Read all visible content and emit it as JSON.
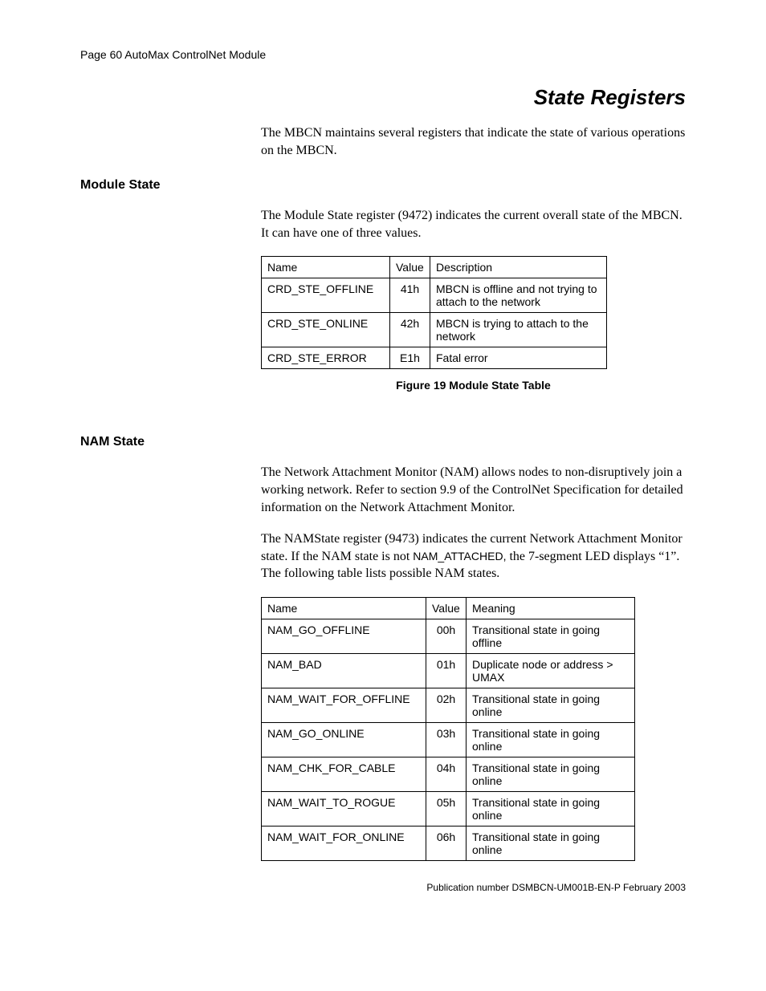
{
  "header": "Page 60  AutoMax ControlNet Module",
  "title": "State Registers",
  "intro": "The MBCN maintains several registers that indicate the state of various operations on the MBCN.",
  "sec1": {
    "heading": "Module State",
    "para": "The Module State register (9472) indicates the current overall state of the MBCN. It can have one of three values.",
    "table": {
      "headers": [
        "Name",
        "Value",
        "Description"
      ],
      "rows": [
        {
          "name": "CRD_STE_OFFLINE",
          "value": "41h",
          "desc": "MBCN is offline and not trying to attach to the network"
        },
        {
          "name": "CRD_STE_ONLINE",
          "value": "42h",
          "desc": "MBCN is trying to attach to the network"
        },
        {
          "name": "CRD_STE_ERROR",
          "value": "E1h",
          "desc": "Fatal error"
        }
      ]
    },
    "caption": "Figure 19 Module State Table"
  },
  "sec2": {
    "heading": "NAM State",
    "para1": "The Network Attachment Monitor (NAM) allows nodes to non-disruptively join a working network.  Refer to section 9.9 of the ControlNet Specification for detailed information on the Network Attachment Monitor.",
    "para2_a": "The NAMState register (9473) indicates the current Network Attachment Monitor state. If the NAM state is not ",
    "para2_code": "NAM_ATTACHED,",
    "para2_b": " the 7-segment LED displays “1”.   The following table lists possible NAM states.",
    "table": {
      "headers": [
        "Name",
        "Value",
        "Meaning"
      ],
      "rows": [
        {
          "name": "NAM_GO_OFFLINE",
          "value": "00h",
          "desc": "Transitional state in going offline"
        },
        {
          "name": "NAM_BAD",
          "value": "01h",
          "desc": "Duplicate node or address > UMAX"
        },
        {
          "name": "NAM_WAIT_FOR_OFFLINE",
          "value": "02h",
          "desc": "Transitional state in going online"
        },
        {
          "name": "NAM_GO_ONLINE",
          "value": "03h",
          "desc": "Transitional state in going online"
        },
        {
          "name": "NAM_CHK_FOR_CABLE",
          "value": "04h",
          "desc": "Transitional state in going online"
        },
        {
          "name": "NAM_WAIT_TO_ROGUE",
          "value": "05h",
          "desc": "Transitional state in going online"
        },
        {
          "name": "NAM_WAIT_FOR_ONLINE",
          "value": "06h",
          "desc": "Transitional state in going online"
        }
      ]
    }
  },
  "footer": "Publication number DSMBCN-UM001B-EN-P February 2003"
}
